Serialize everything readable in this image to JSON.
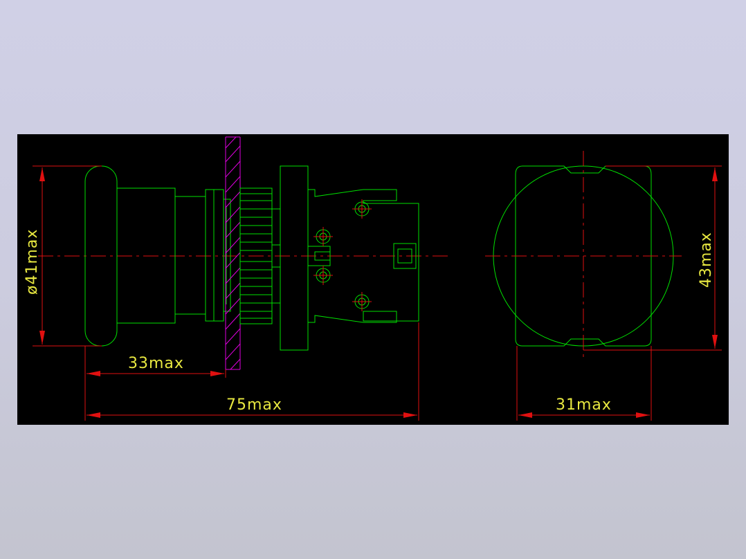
{
  "drawing": {
    "background_color": "#000000",
    "line_color": "#00e000",
    "dimension_color": "#e01010",
    "text_color": "#e8e840",
    "section_hatch_color": "#e000e0",
    "dimensions": {
      "diameter": "ø41max",
      "offset": "33max",
      "overall_length": "75max",
      "width": "31max",
      "height": "43max"
    }
  }
}
